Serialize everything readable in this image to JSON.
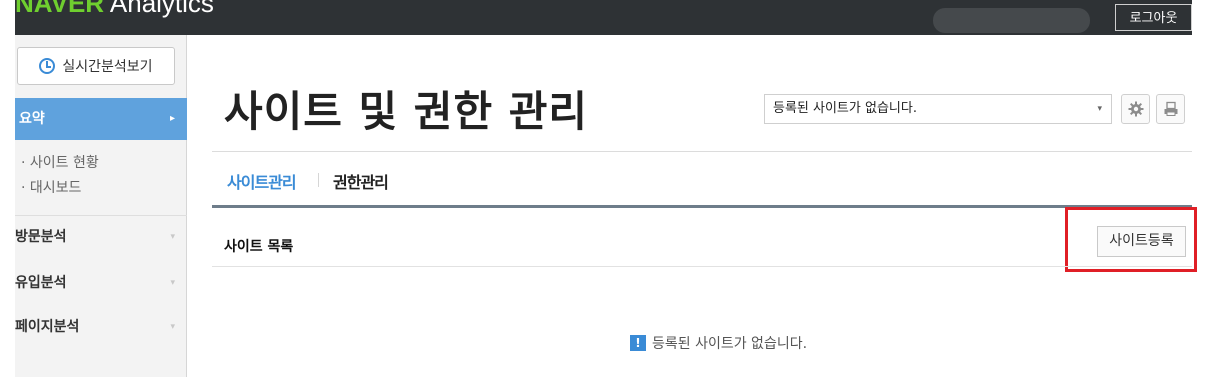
{
  "topbar": {
    "logo_brand": "NAVER",
    "logo_product": "Analytics",
    "logout_label": "로그아웃"
  },
  "sidebar": {
    "realtime_label": "실시간분석보기",
    "summary_label": "요약",
    "summary_arrow": "▸",
    "sub_items": [
      "· 사이트 현황",
      "· 대시보드"
    ],
    "menu_items": [
      "방문분석",
      "유입분석",
      "페이지분석"
    ],
    "caret": "▾"
  },
  "main": {
    "title": "사이트 및 권한 관리",
    "site_select_value": "등록된 사이트가 없습니다.",
    "select_arrow": "▾",
    "tabs": [
      "사이트관리",
      "권한관리"
    ],
    "section_title": "사이트 목록",
    "register_label": "사이트등록",
    "empty_message": "등록된 사이트가 없습니다.",
    "info_glyph": "!"
  },
  "colors": {
    "accent": "#3a8bd6",
    "sidebar_active": "#5fa2dd",
    "topbar": "#2e3235",
    "highlight": "#e01f26"
  },
  "icons": [
    "clock-icon",
    "gear-icon",
    "print-icon",
    "info-icon"
  ]
}
